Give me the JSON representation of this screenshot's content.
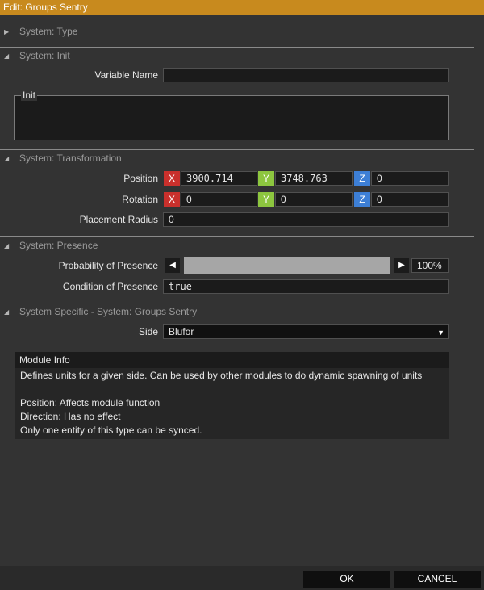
{
  "window": {
    "title": "Edit: Groups Sentry"
  },
  "sections": {
    "type": {
      "label": "System: Type"
    },
    "init": {
      "label": "System: Init"
    },
    "transformation": {
      "label": "System: Transformation"
    },
    "presence": {
      "label": "System: Presence"
    },
    "specific": {
      "label": "System Specific - System: Groups Sentry"
    }
  },
  "init": {
    "variable_name_label": "Variable Name",
    "variable_name_value": "",
    "init_label": "Init",
    "init_value": ""
  },
  "transformation": {
    "position_label": "Position",
    "position": {
      "x": "3900.714",
      "y": "3748.763",
      "z": "0"
    },
    "rotation_label": "Rotation",
    "rotation": {
      "x": "0",
      "y": "0",
      "z": "0"
    },
    "placement_radius_label": "Placement Radius",
    "placement_radius_value": "0",
    "axis_x": "X",
    "axis_y": "Y",
    "axis_z": "Z"
  },
  "presence": {
    "probability_label": "Probability of Presence",
    "probability_value": "100%",
    "probability_fraction": 1.0,
    "condition_label": "Condition of Presence",
    "condition_value": "true"
  },
  "specific": {
    "side_label": "Side",
    "side_value": "Blufor"
  },
  "module_info": {
    "title": "Module Info",
    "lines": [
      "Defines units for a given side. Can be used by other modules to do dynamic spawning of units",
      "",
      "Position: Affects module function",
      "Direction: Has no effect",
      "Only one entity of this type can be synced."
    ]
  },
  "footer": {
    "ok_label": "OK",
    "cancel_label": "CANCEL"
  },
  "icons": {
    "collapsed": "triangle-right-icon",
    "expanded": "triangle-down-icon"
  },
  "colors": {
    "title_bar": "#c88a1e",
    "axis_x": "#c9302c",
    "axis_y": "#8dc63f",
    "axis_z": "#3d7fd6"
  }
}
